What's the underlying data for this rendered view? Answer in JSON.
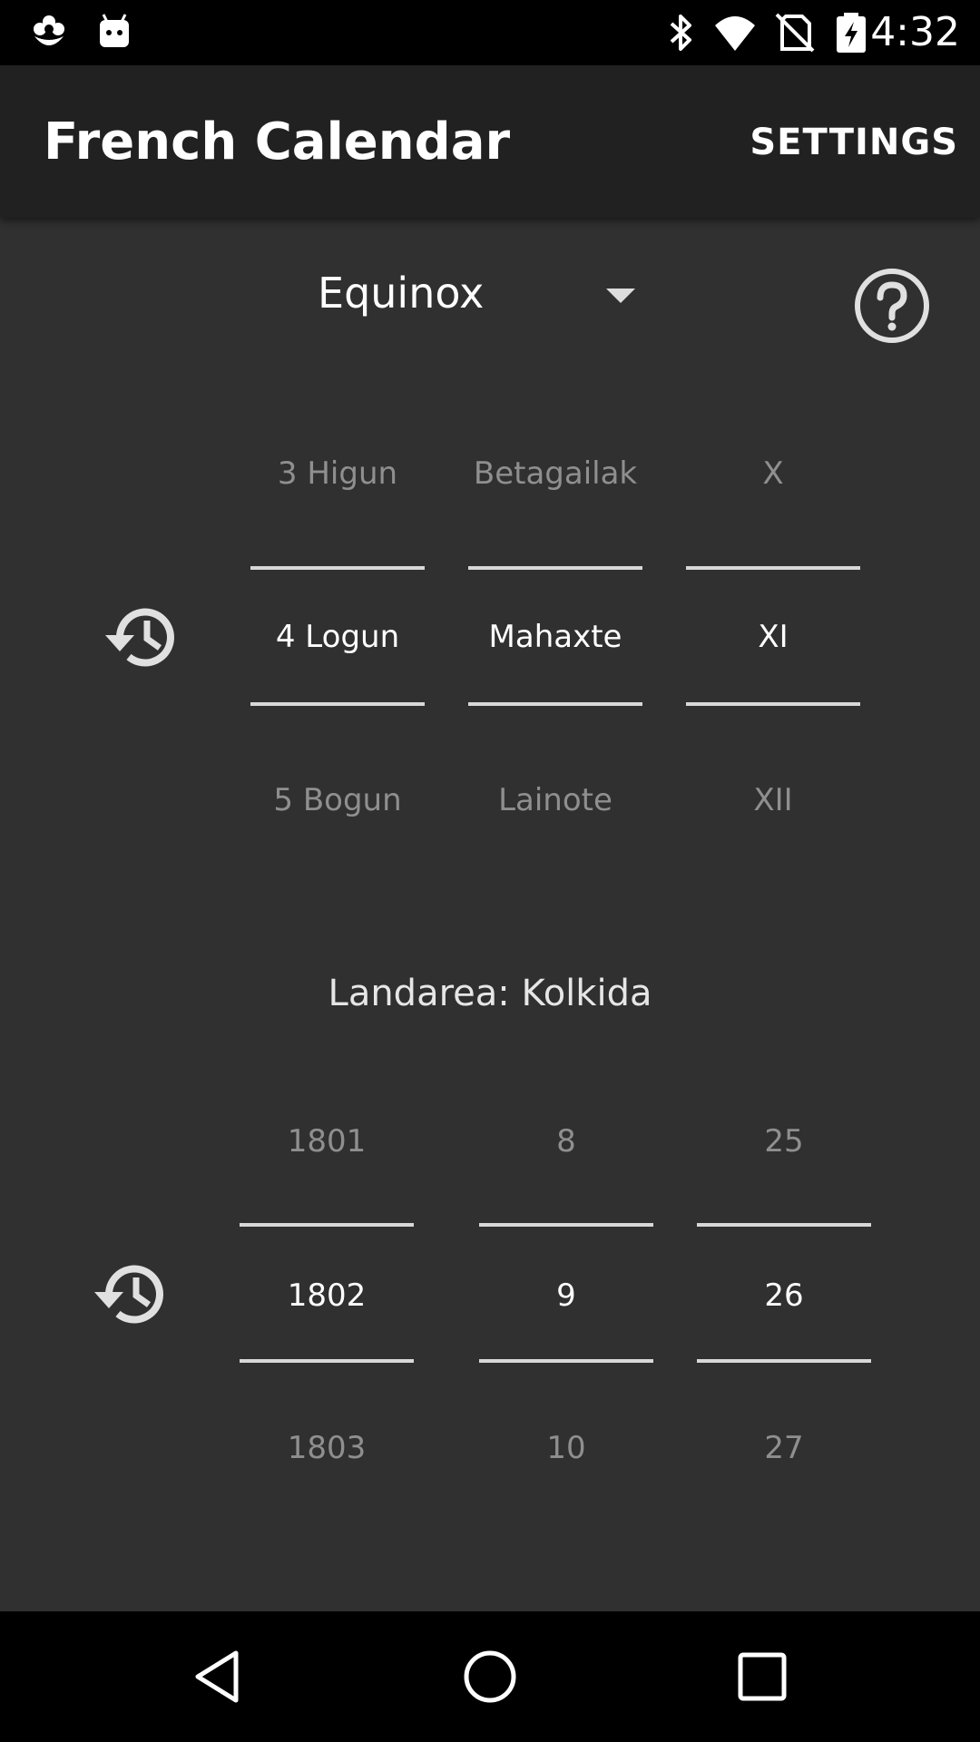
{
  "status_bar": {
    "time": "4:32",
    "left_icons": [
      "flower-notification-icon",
      "android-notification-icon"
    ],
    "right_icons": [
      "bluetooth-icon",
      "wifi-icon",
      "no-sim-icon",
      "battery-charging-icon"
    ]
  },
  "app_bar": {
    "title": "French Calendar",
    "settings_label": "SETTINGS"
  },
  "mode_spinner": {
    "selected": "Equinox"
  },
  "help_icon": "help-circle-icon",
  "french_date_picker": {
    "day": {
      "prev": "3 Higun",
      "current": "4 Logun",
      "next": "5 Bogun"
    },
    "month": {
      "prev": "Betagailak",
      "current": "Mahaxte",
      "next": "Lainote"
    },
    "year": {
      "prev": "X",
      "current": "XI",
      "next": "XII"
    }
  },
  "landarea_text": "Landarea: Kolkida",
  "gregorian_date_picker": {
    "year": {
      "prev": "1801",
      "current": "1802",
      "next": "1803"
    },
    "month": {
      "prev": "8",
      "current": "9",
      "next": "10"
    },
    "day": {
      "prev": "25",
      "current": "26",
      "next": "27"
    }
  },
  "nav_bar": {
    "icons": [
      "back-icon",
      "home-icon",
      "recents-icon"
    ]
  },
  "colors": {
    "background": "#303030",
    "app_bar": "#212121",
    "dim_text": "#8f8f8f",
    "divider": "#d8d8d8"
  }
}
